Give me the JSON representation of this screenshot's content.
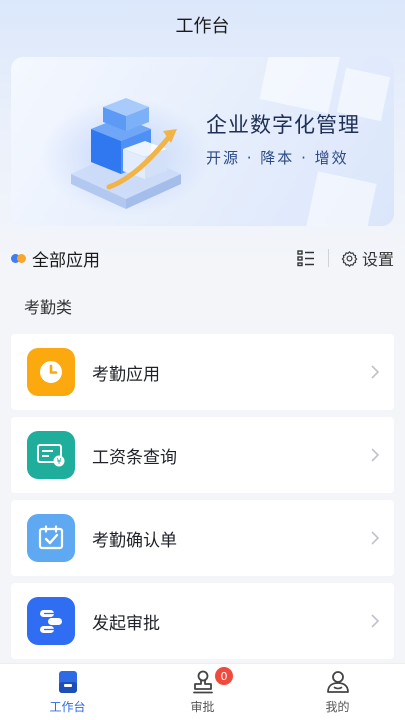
{
  "header": {
    "title": "工作台"
  },
  "banner": {
    "title": "企业数字化管理",
    "subtitle": "开源 · 降本 · 增效"
  },
  "section": {
    "title": "全部应用",
    "settings_label": "设置"
  },
  "category": {
    "label": "考勤类"
  },
  "apps": [
    {
      "label": "考勤应用",
      "icon": "clock-icon",
      "color": "#fba90f"
    },
    {
      "label": "工资条查询",
      "icon": "payslip-icon",
      "color": "#1fae9b"
    },
    {
      "label": "考勤确认单",
      "icon": "calendar-check-icon",
      "color": "#5ea9f2"
    },
    {
      "label": "发起审批",
      "icon": "approval-flow-icon",
      "color": "#2f6ef2"
    }
  ],
  "tabbar": {
    "items": [
      {
        "label": "工作台",
        "icon": "workbench-icon",
        "active": true
      },
      {
        "label": "审批",
        "icon": "stamp-icon",
        "badge": "0"
      },
      {
        "label": "我的",
        "icon": "user-icon"
      }
    ]
  },
  "colors": {
    "accent": "#2e6ae5",
    "badge": "#f04a3c"
  }
}
